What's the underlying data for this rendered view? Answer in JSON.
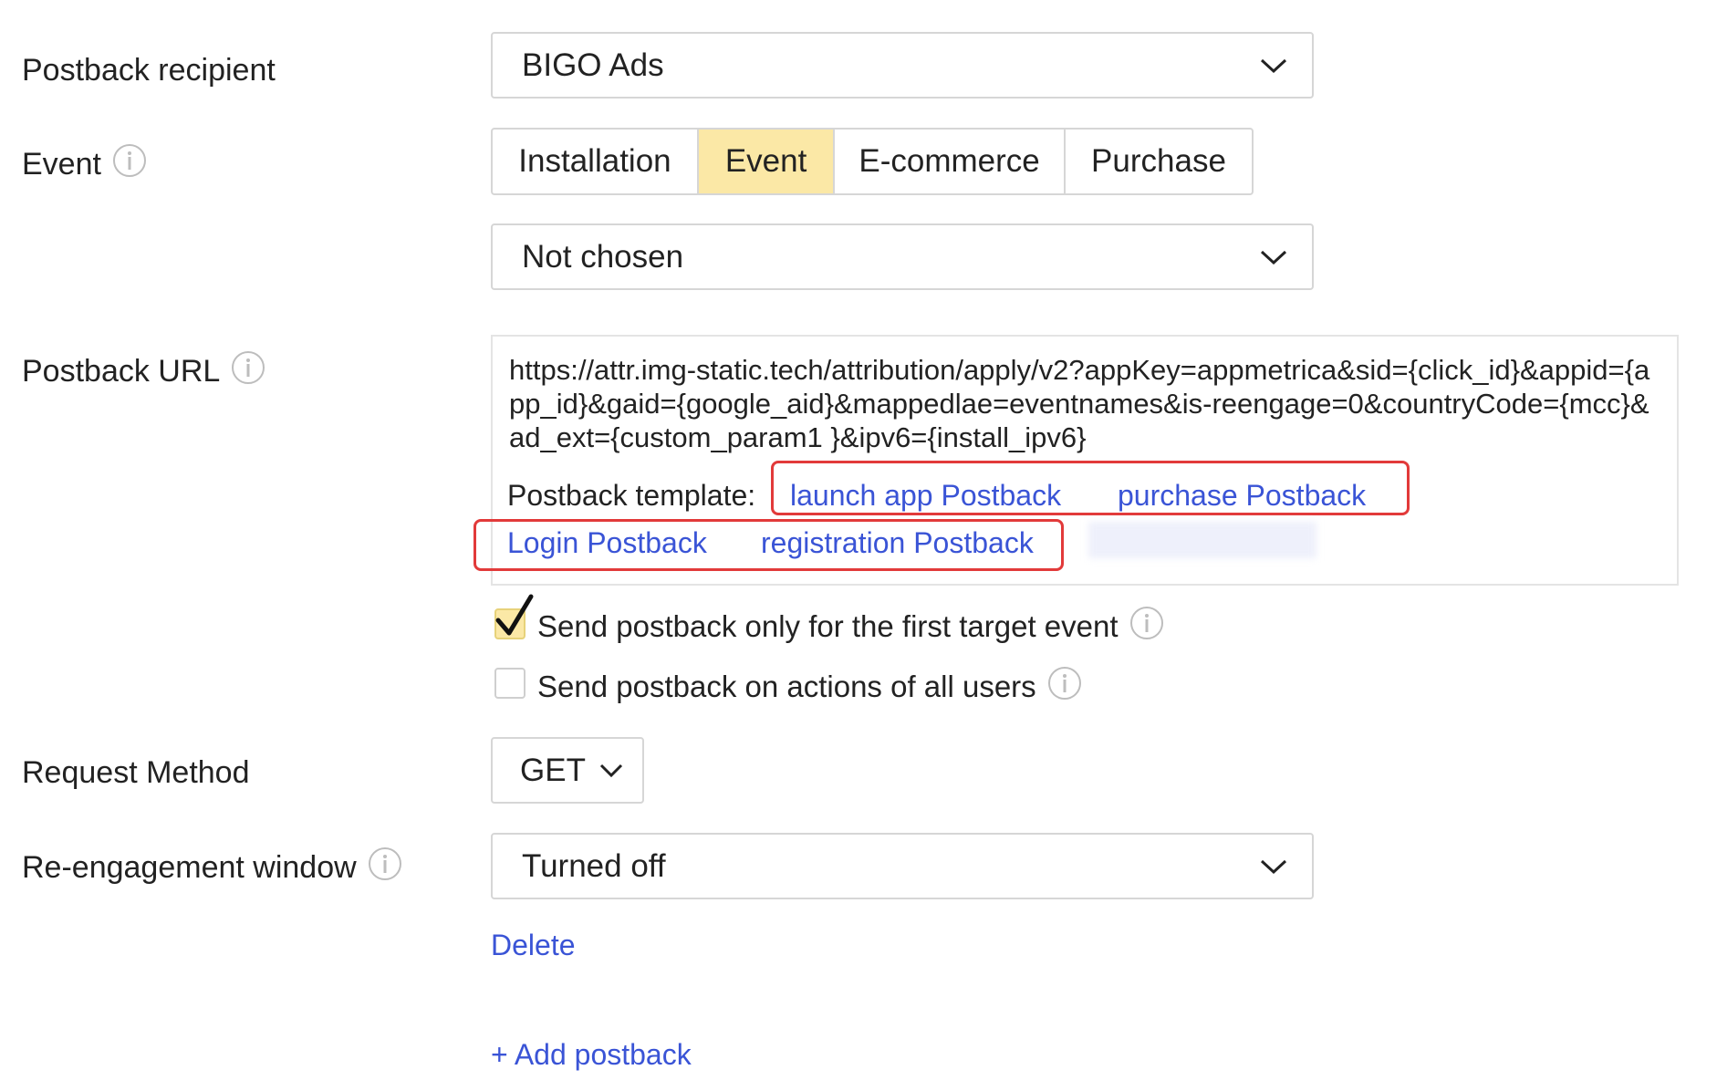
{
  "labels": {
    "postback_recipient": "Postback recipient",
    "event": "Event",
    "postback_url": "Postback URL",
    "request_method": "Request Method",
    "reengagement_window": "Re-engagement window"
  },
  "recipient_select": {
    "value": "BIGO Ads"
  },
  "event_tabs": [
    {
      "label": "Installation",
      "active": false
    },
    {
      "label": "Event",
      "active": true
    },
    {
      "label": "E-commerce",
      "active": false
    },
    {
      "label": "Purchase",
      "active": false
    }
  ],
  "event_select": {
    "value": "Not chosen"
  },
  "postback_url": {
    "value": "https://attr.img-static.tech/attribution/apply/v2?appKey=appmetrica&sid={click_id}&appid={app_id}&gaid={google_aid}&mappedlae=eventnames&is-reengage=0&countryCode={mcc}&ad_ext={custom_param1 }&ipv6={install_ipv6}",
    "template_label": "Postback template:",
    "templates": [
      "launch app Postback",
      "purchase Postback",
      "Login Postback",
      "registration Postback"
    ]
  },
  "checkboxes": [
    {
      "label": "Send postback only for the first target event",
      "checked": true
    },
    {
      "label": "Send postback on actions of all users",
      "checked": false
    }
  ],
  "request_method": {
    "value": "GET"
  },
  "reengagement_select": {
    "value": "Turned off"
  },
  "actions": {
    "delete": "Delete",
    "add_postback": "+ Add postback"
  },
  "colors": {
    "accent": "#fbe8a6",
    "link": "#3a54d6",
    "highlight": "#e23a3a",
    "border": "#d6d6d6"
  },
  "icons": [
    "info-icon",
    "chevron-down-icon",
    "checkmark-icon"
  ]
}
